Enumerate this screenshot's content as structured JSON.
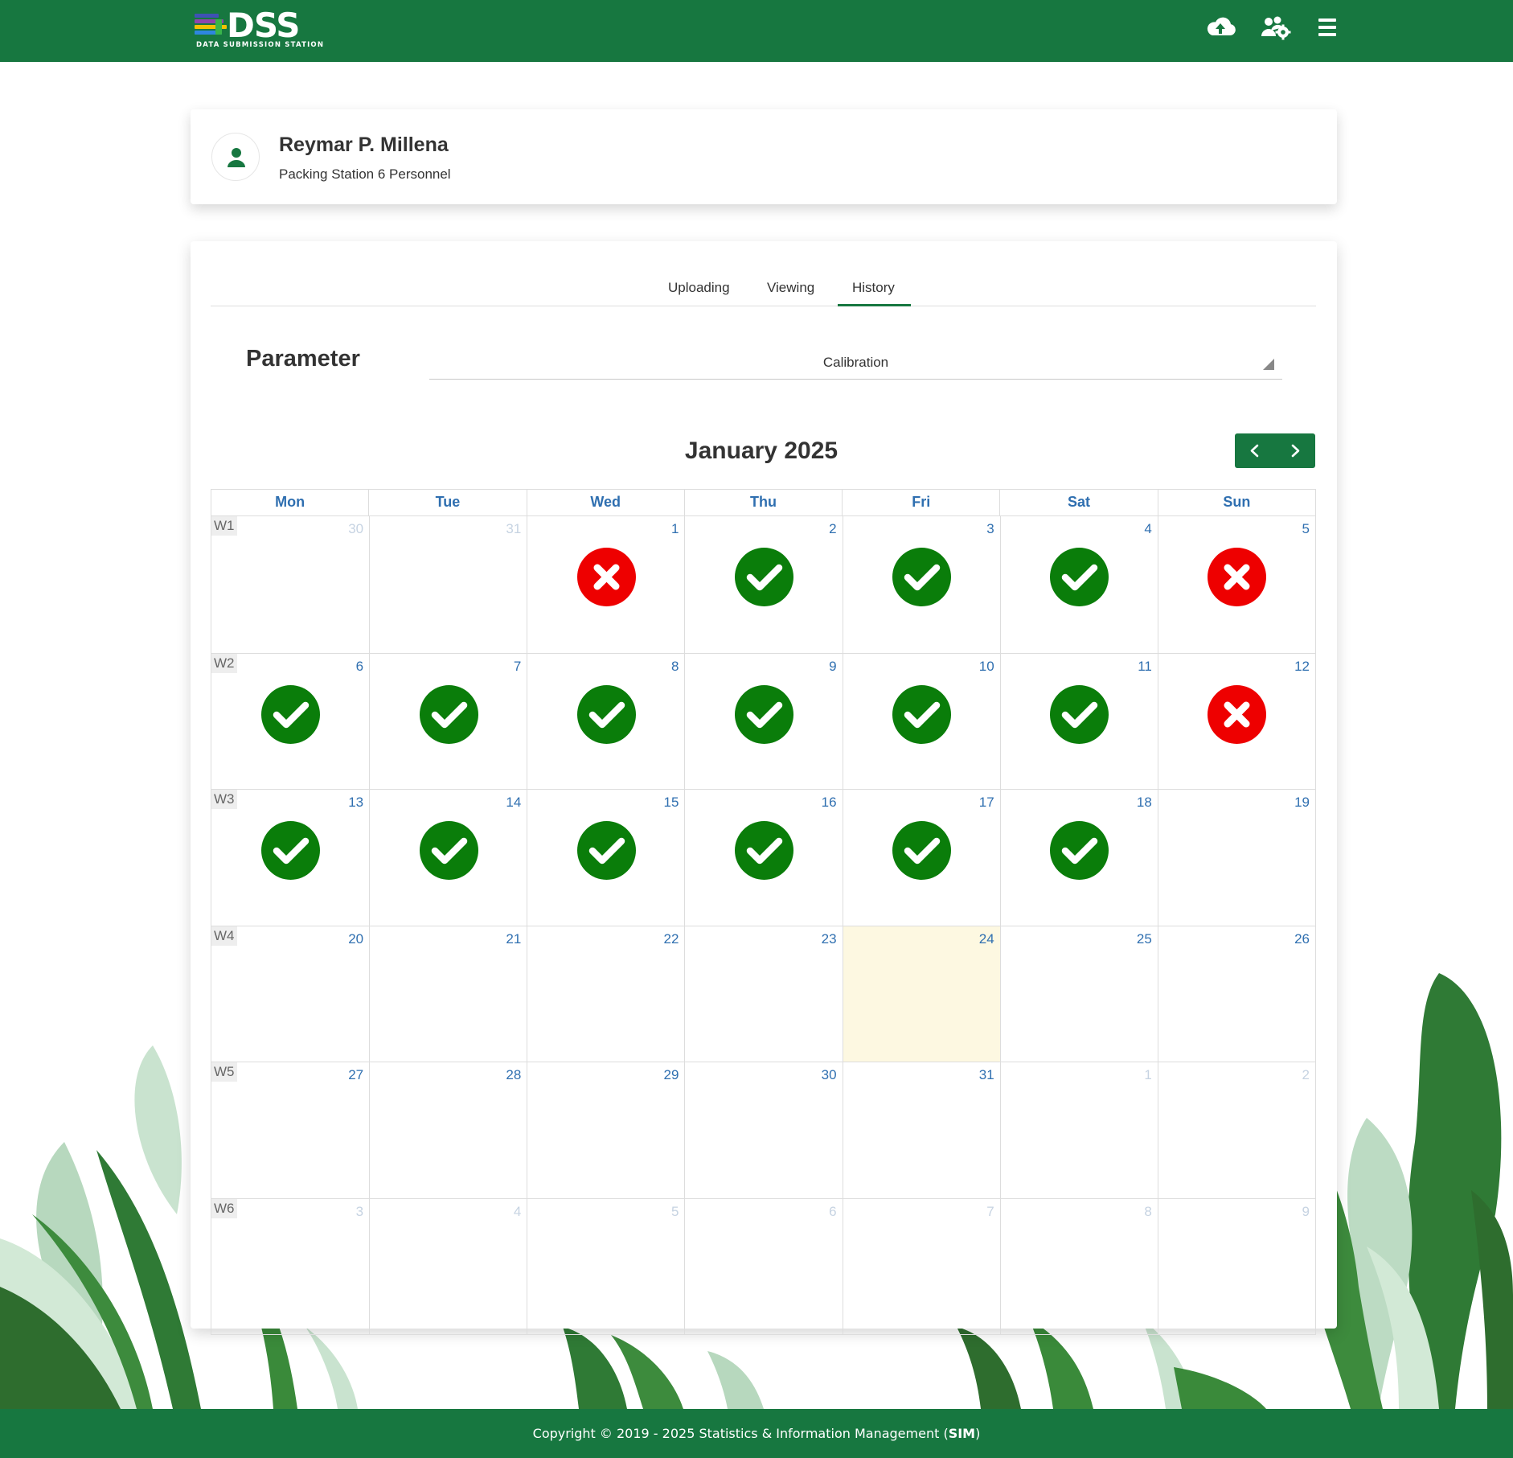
{
  "app": {
    "logo_text": "DSS",
    "logo_subtitle": "DATA SUBMISSION STATION",
    "brand_color": "#177740"
  },
  "navbar": {
    "icons": [
      "cloud-upload-icon",
      "users-gear-icon",
      "hamburger-menu-icon"
    ]
  },
  "profile": {
    "name": "Reymar P. Millena",
    "role": "Packing Station 6 Personnel",
    "icon": "user-icon"
  },
  "tabs": [
    {
      "label": "Uploading",
      "active": false
    },
    {
      "label": "Viewing",
      "active": false
    },
    {
      "label": "History",
      "active": true
    }
  ],
  "parameter": {
    "label": "Parameter",
    "selected": "Calibration"
  },
  "calendar": {
    "title": "January 2025",
    "weekdays": [
      "Mon",
      "Tue",
      "Wed",
      "Thu",
      "Fri",
      "Sat",
      "Sun"
    ],
    "today_color": "#fdf8e1",
    "status_colors": {
      "pass": "#0a7d0a",
      "fail": "#ee0000"
    },
    "weeks": [
      {
        "label": "W1",
        "days": [
          {
            "day": "30",
            "other": true
          },
          {
            "day": "31",
            "other": true
          },
          {
            "day": "1",
            "status": "fail"
          },
          {
            "day": "2",
            "status": "pass"
          },
          {
            "day": "3",
            "status": "pass"
          },
          {
            "day": "4",
            "status": "pass"
          },
          {
            "day": "5",
            "status": "fail"
          }
        ]
      },
      {
        "label": "W2",
        "days": [
          {
            "day": "6",
            "status": "pass"
          },
          {
            "day": "7",
            "status": "pass"
          },
          {
            "day": "8",
            "status": "pass"
          },
          {
            "day": "9",
            "status": "pass"
          },
          {
            "day": "10",
            "status": "pass"
          },
          {
            "day": "11",
            "status": "pass"
          },
          {
            "day": "12",
            "status": "fail"
          }
        ]
      },
      {
        "label": "W3",
        "days": [
          {
            "day": "13",
            "status": "pass"
          },
          {
            "day": "14",
            "status": "pass"
          },
          {
            "day": "15",
            "status": "pass"
          },
          {
            "day": "16",
            "status": "pass"
          },
          {
            "day": "17",
            "status": "pass"
          },
          {
            "day": "18",
            "status": "pass"
          },
          {
            "day": "19"
          }
        ]
      },
      {
        "label": "W4",
        "days": [
          {
            "day": "20"
          },
          {
            "day": "21"
          },
          {
            "day": "22"
          },
          {
            "day": "23"
          },
          {
            "day": "24",
            "today": true
          },
          {
            "day": "25"
          },
          {
            "day": "26"
          }
        ]
      },
      {
        "label": "W5",
        "days": [
          {
            "day": "27"
          },
          {
            "day": "28"
          },
          {
            "day": "29"
          },
          {
            "day": "30"
          },
          {
            "day": "31"
          },
          {
            "day": "1",
            "other": true
          },
          {
            "day": "2",
            "other": true
          }
        ]
      },
      {
        "label": "W6",
        "days": [
          {
            "day": "3",
            "other": true
          },
          {
            "day": "4",
            "other": true
          },
          {
            "day": "5",
            "other": true
          },
          {
            "day": "6",
            "other": true
          },
          {
            "day": "7",
            "other": true
          },
          {
            "day": "8",
            "other": true
          },
          {
            "day": "9",
            "other": true
          }
        ]
      }
    ]
  },
  "footer": {
    "text": "Copyright © 2019 - 2025 Statistics & Information Management (",
    "bold": "SIM",
    "end": ")"
  }
}
